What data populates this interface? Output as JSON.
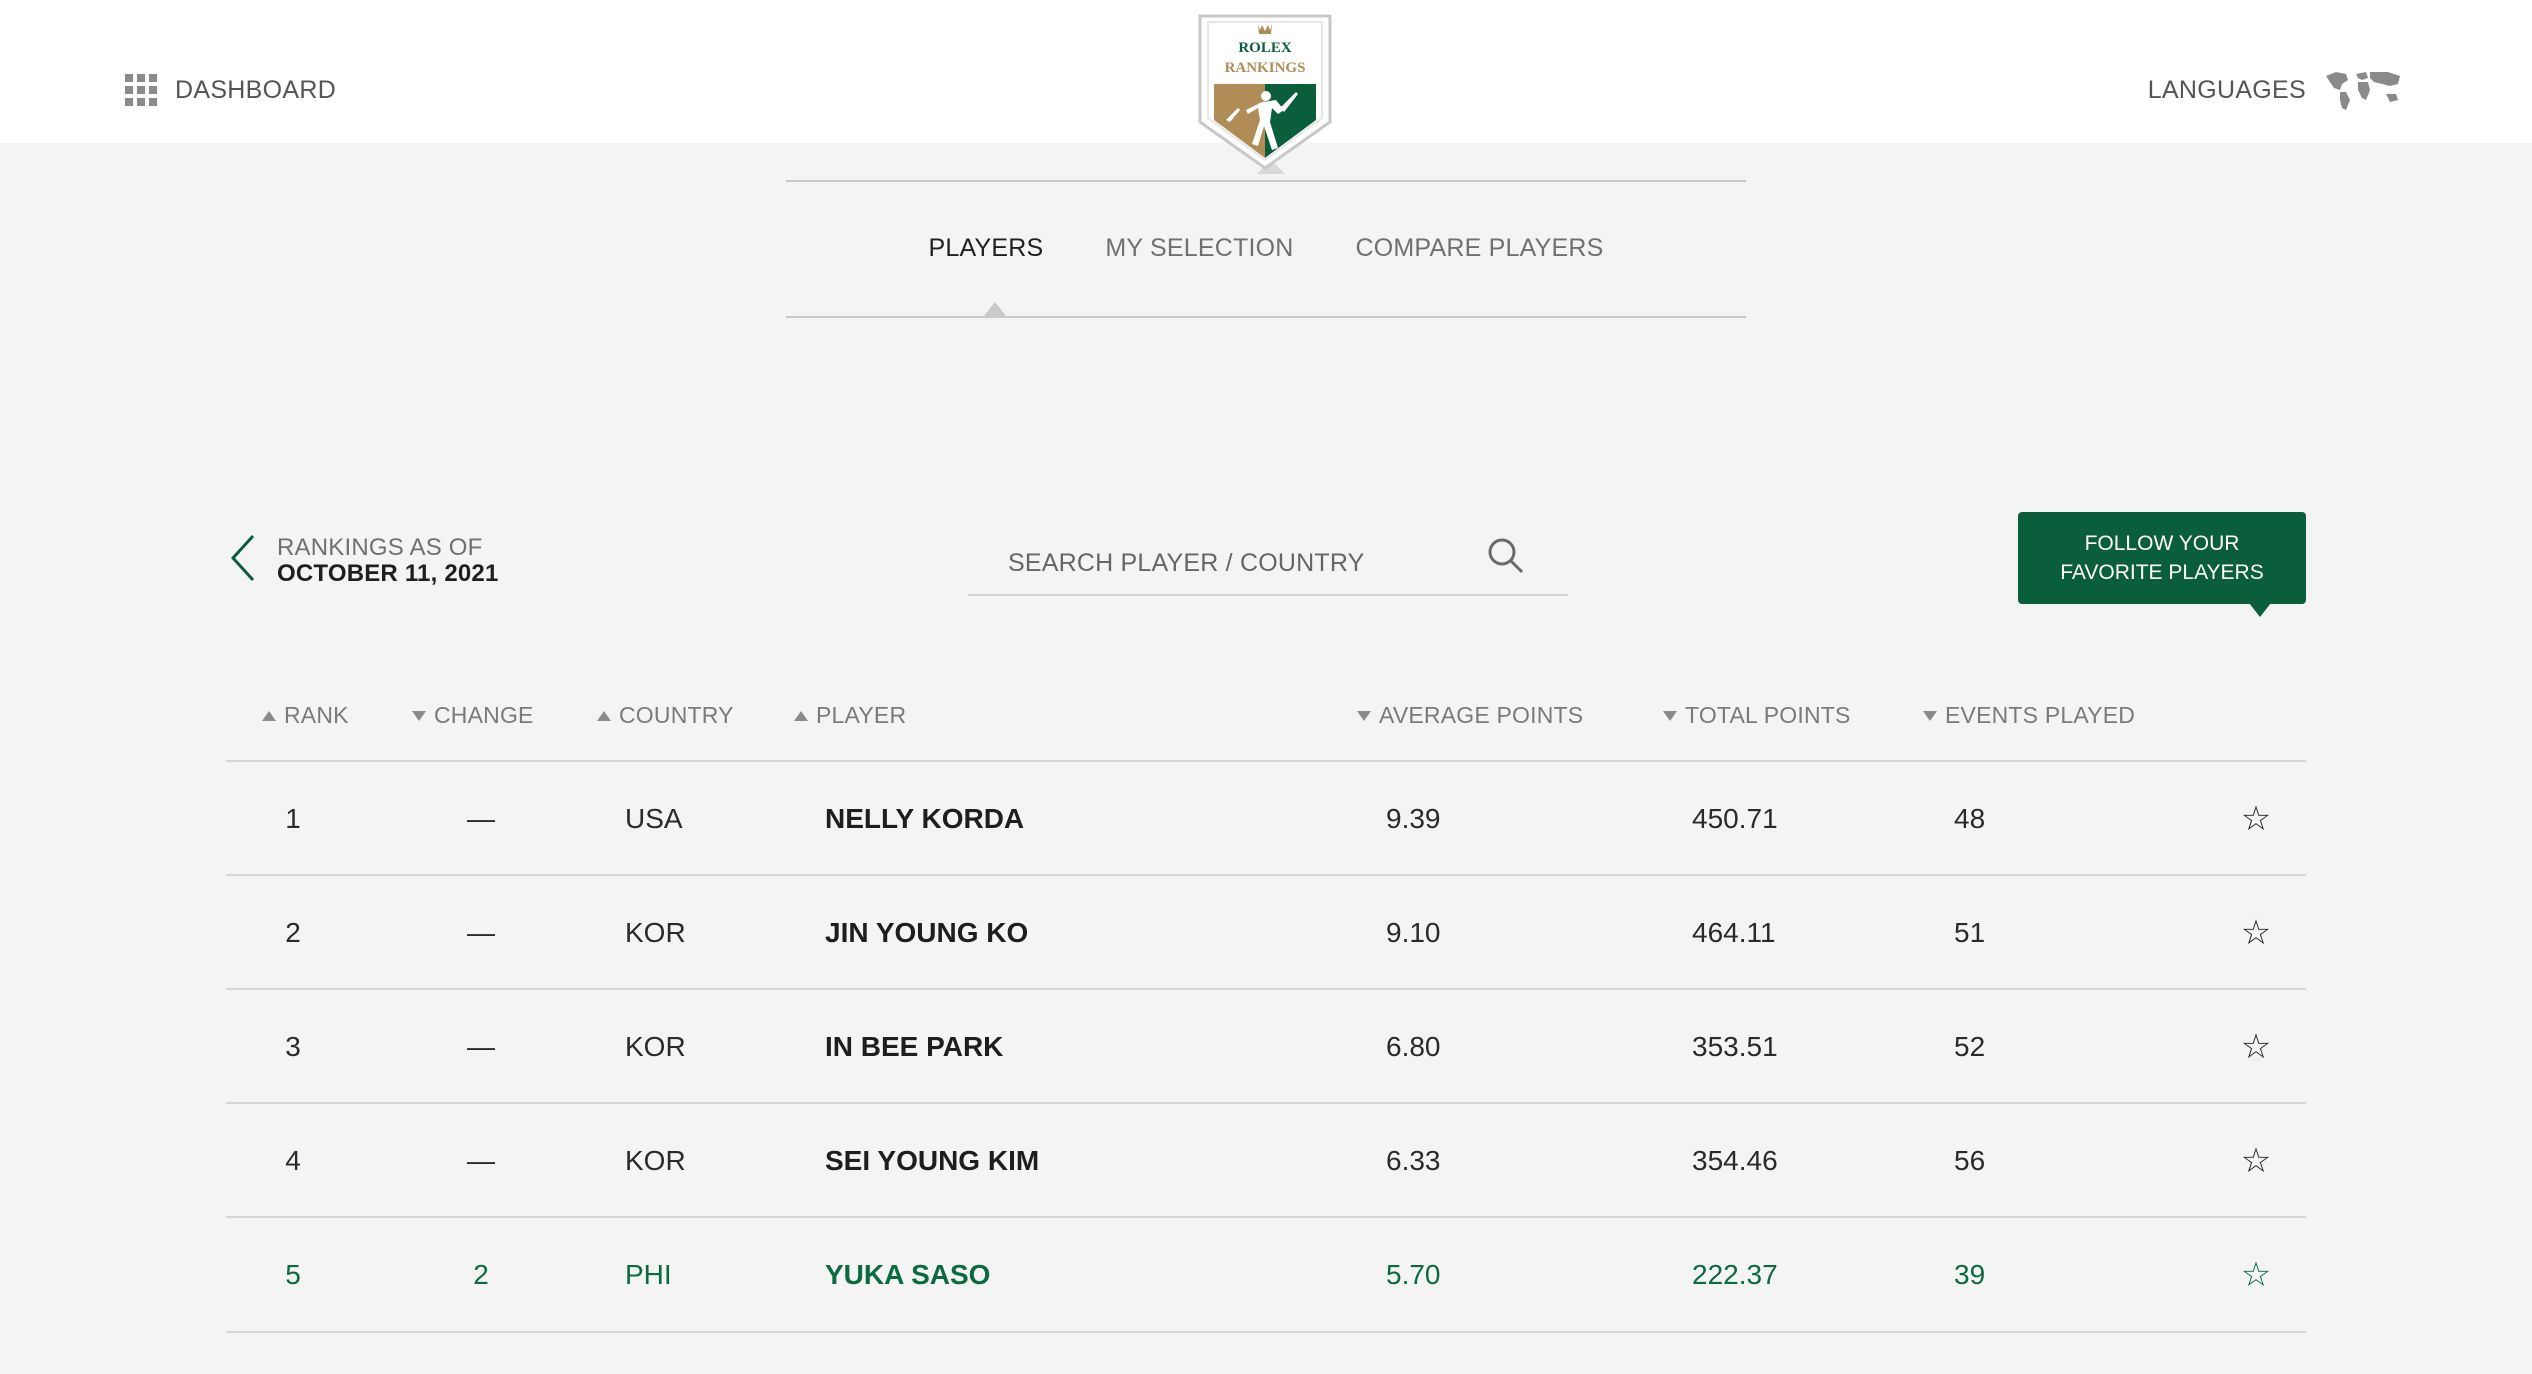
{
  "header": {
    "dashboard_label": "DASHBOARD",
    "languages_label": "LANGUAGES",
    "logo": {
      "line1": "ROLEX",
      "line2": "RANKINGS"
    }
  },
  "nav": {
    "tabs": [
      {
        "label": "PLAYERS",
        "active": true
      },
      {
        "label": "MY SELECTION",
        "active": false
      },
      {
        "label": "COMPARE PLAYERS",
        "active": false
      }
    ]
  },
  "controls": {
    "rankings_as_of_label": "RANKINGS AS OF",
    "rankings_date": "OCTOBER 11, 2021",
    "search_placeholder": "SEARCH PLAYER / COUNTRY",
    "follow_line1": "FOLLOW YOUR",
    "follow_line2": "FAVORITE PLAYERS"
  },
  "table": {
    "columns": [
      {
        "label": "RANK",
        "sort": "up"
      },
      {
        "label": "CHANGE",
        "sort": "down"
      },
      {
        "label": "COUNTRY",
        "sort": "up"
      },
      {
        "label": "PLAYER",
        "sort": "up"
      },
      {
        "label": "AVERAGE POINTS",
        "sort": "down"
      },
      {
        "label": "TOTAL POINTS",
        "sort": "down"
      },
      {
        "label": "EVENTS PLAYED",
        "sort": "down"
      }
    ],
    "rows": [
      {
        "rank": "1",
        "change": "—",
        "country": "USA",
        "player": "NELLY KORDA",
        "avg": "9.39",
        "total": "450.71",
        "events": "48",
        "star": "☆"
      },
      {
        "rank": "2",
        "change": "—",
        "country": "KOR",
        "player": "JIN YOUNG KO",
        "avg": "9.10",
        "total": "464.11",
        "events": "51",
        "star": "☆"
      },
      {
        "rank": "3",
        "change": "—",
        "country": "KOR",
        "player": "IN BEE PARK",
        "avg": "6.80",
        "total": "353.51",
        "events": "52",
        "star": "☆"
      },
      {
        "rank": "4",
        "change": "—",
        "country": "KOR",
        "player": "SEI YOUNG KIM",
        "avg": "6.33",
        "total": "354.46",
        "events": "56",
        "star": "☆"
      },
      {
        "rank": "5",
        "change": "2",
        "country": "PHI",
        "player": "YUKA SASO",
        "avg": "5.70",
        "total": "222.37",
        "events": "39",
        "star": "☆"
      }
    ]
  },
  "colors": {
    "brand_green": "#0b5e3b",
    "highlight_green": "#0b6b40",
    "gold": "#b08d57",
    "background": "#f4f4f4"
  },
  "icons": [
    "grid-icon",
    "world-map-icon",
    "chevron-left-icon",
    "search-icon",
    "star-icon",
    "crown-icon"
  ]
}
